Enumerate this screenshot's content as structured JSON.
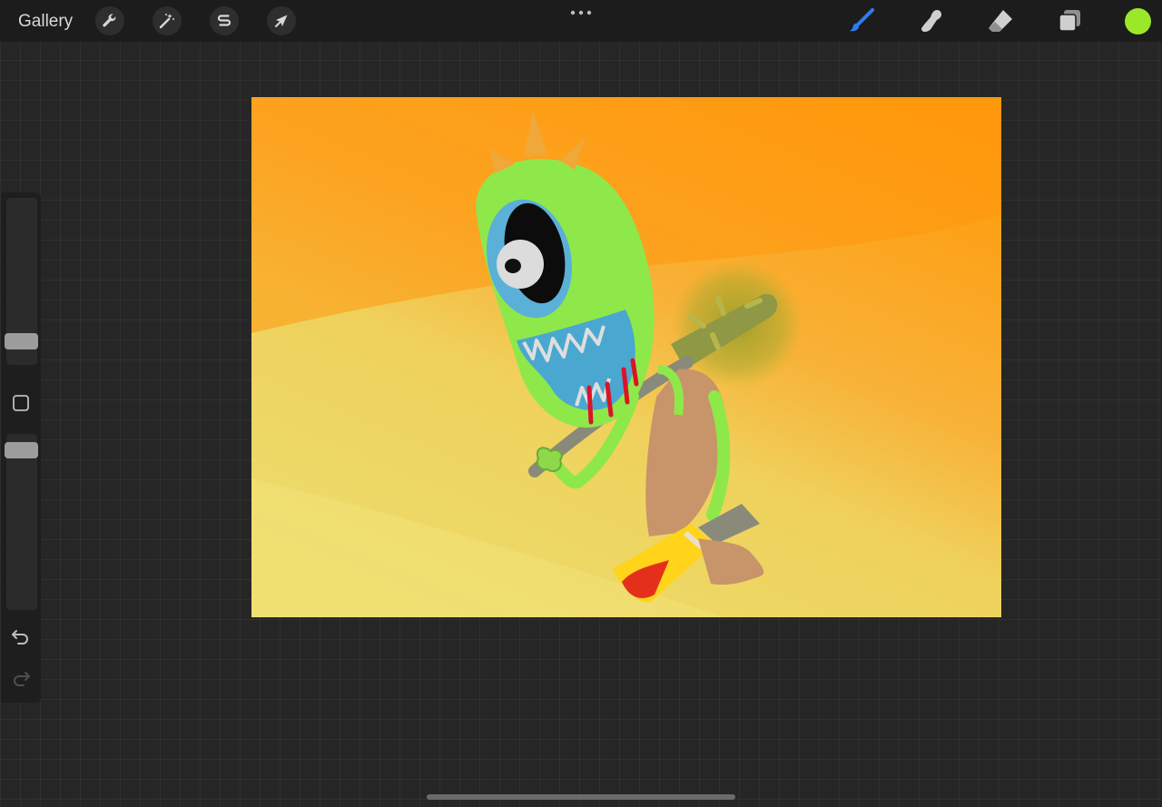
{
  "topbar": {
    "gallery_label": "Gallery",
    "left_tools": [
      {
        "name": "actions",
        "icon": "wrench-icon"
      },
      {
        "name": "adjustments",
        "icon": "magic-wand-icon"
      },
      {
        "name": "selection",
        "icon": "selection-s-icon"
      },
      {
        "name": "transform",
        "icon": "arrow-cursor-icon"
      }
    ],
    "more_icon": "more-dots-icon",
    "right_tools": [
      {
        "name": "brush",
        "icon": "brush-icon",
        "active": true,
        "color": "#2f7bf0"
      },
      {
        "name": "smudge",
        "icon": "smudge-icon",
        "active": false,
        "color": "#cfcfcf"
      },
      {
        "name": "eraser",
        "icon": "eraser-icon",
        "active": false,
        "color": "#cfcfcf"
      },
      {
        "name": "layers",
        "icon": "layers-icon",
        "active": false,
        "color": "#cfcfcf"
      }
    ],
    "current_color": "#9be82a"
  },
  "sidebar": {
    "brush_size_level": 0.1,
    "opacity_level": 0.95,
    "modify_icon": "square-modify-icon",
    "undo_icon": "undo-icon",
    "redo_icon": "redo-icon",
    "redo_enabled": false
  },
  "canvas": {
    "description_icon": "artwork-canvas",
    "background_colors": [
      "#ff9a0a",
      "#f6c04a",
      "#ecdc6c"
    ],
    "monster_color": "#8fe84a",
    "blood_color": "#d9142a"
  }
}
